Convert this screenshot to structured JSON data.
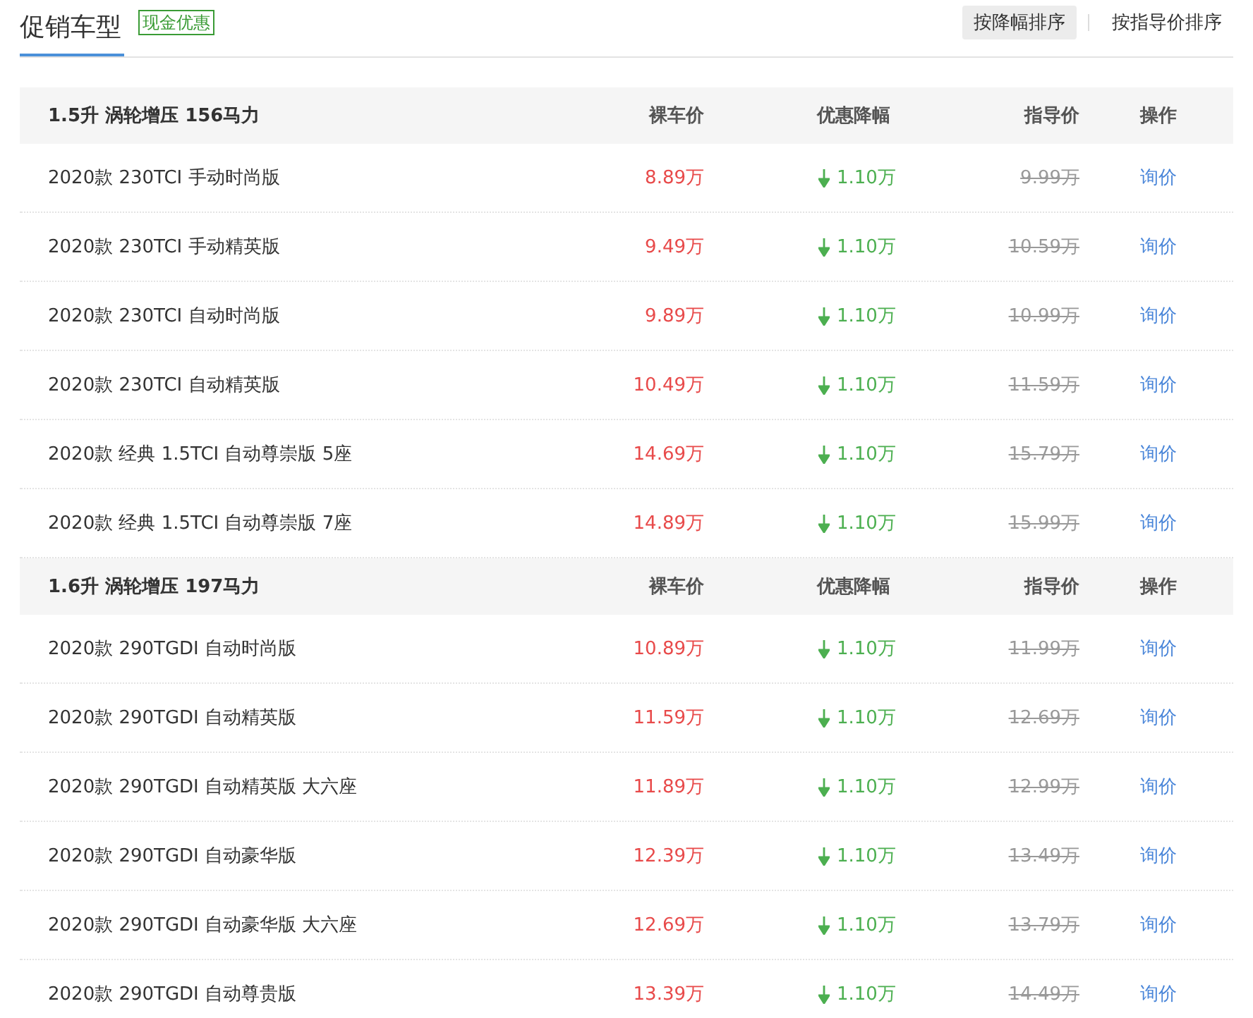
{
  "header": {
    "title": "促销车型",
    "tag": "现金优惠",
    "sort_options": [
      {
        "label": "按降幅排序",
        "selected": true
      },
      {
        "label": "按指导价排序",
        "selected": false
      }
    ]
  },
  "groups": [
    {
      "title": "1.5升 涡轮增压 156马力",
      "columns": [
        "裸车价",
        "优惠降幅",
        "指导价",
        "操作"
      ],
      "rows": [
        {
          "name": "2020款 230TCI 手动时尚版",
          "price": "8.89万",
          "discount": "1.10万",
          "msrp": "9.99万",
          "action": "询价"
        },
        {
          "name": "2020款 230TCI 手动精英版",
          "price": "9.49万",
          "discount": "1.10万",
          "msrp": "10.59万",
          "action": "询价"
        },
        {
          "name": "2020款 230TCI 自动时尚版",
          "price": "9.89万",
          "discount": "1.10万",
          "msrp": "10.99万",
          "action": "询价"
        },
        {
          "name": "2020款 230TCI 自动精英版",
          "price": "10.49万",
          "discount": "1.10万",
          "msrp": "11.59万",
          "action": "询价"
        },
        {
          "name": "2020款 经典 1.5TCI 自动尊崇版 5座",
          "price": "14.69万",
          "discount": "1.10万",
          "msrp": "15.79万",
          "action": "询价"
        },
        {
          "name": "2020款 经典 1.5TCI 自动尊崇版 7座",
          "price": "14.89万",
          "discount": "1.10万",
          "msrp": "15.99万",
          "action": "询价"
        }
      ]
    },
    {
      "title": "1.6升 涡轮增压 197马力",
      "columns": [
        "裸车价",
        "优惠降幅",
        "指导价",
        "操作"
      ],
      "rows": [
        {
          "name": "2020款 290TGDI 自动时尚版",
          "price": "10.89万",
          "discount": "1.10万",
          "msrp": "11.99万",
          "action": "询价"
        },
        {
          "name": "2020款 290TGDI 自动精英版",
          "price": "11.59万",
          "discount": "1.10万",
          "msrp": "12.69万",
          "action": "询价"
        },
        {
          "name": "2020款 290TGDI 自动精英版 大六座",
          "price": "11.89万",
          "discount": "1.10万",
          "msrp": "12.99万",
          "action": "询价"
        },
        {
          "name": "2020款 290TGDI 自动豪华版",
          "price": "12.39万",
          "discount": "1.10万",
          "msrp": "13.49万",
          "action": "询价"
        },
        {
          "name": "2020款 290TGDI 自动豪华版 大六座",
          "price": "12.69万",
          "discount": "1.10万",
          "msrp": "13.79万",
          "action": "询价"
        },
        {
          "name": "2020款 290TGDI 自动尊贵版",
          "price": "13.39万",
          "discount": "1.10万",
          "msrp": "14.49万",
          "action": "询价"
        }
      ]
    }
  ]
}
